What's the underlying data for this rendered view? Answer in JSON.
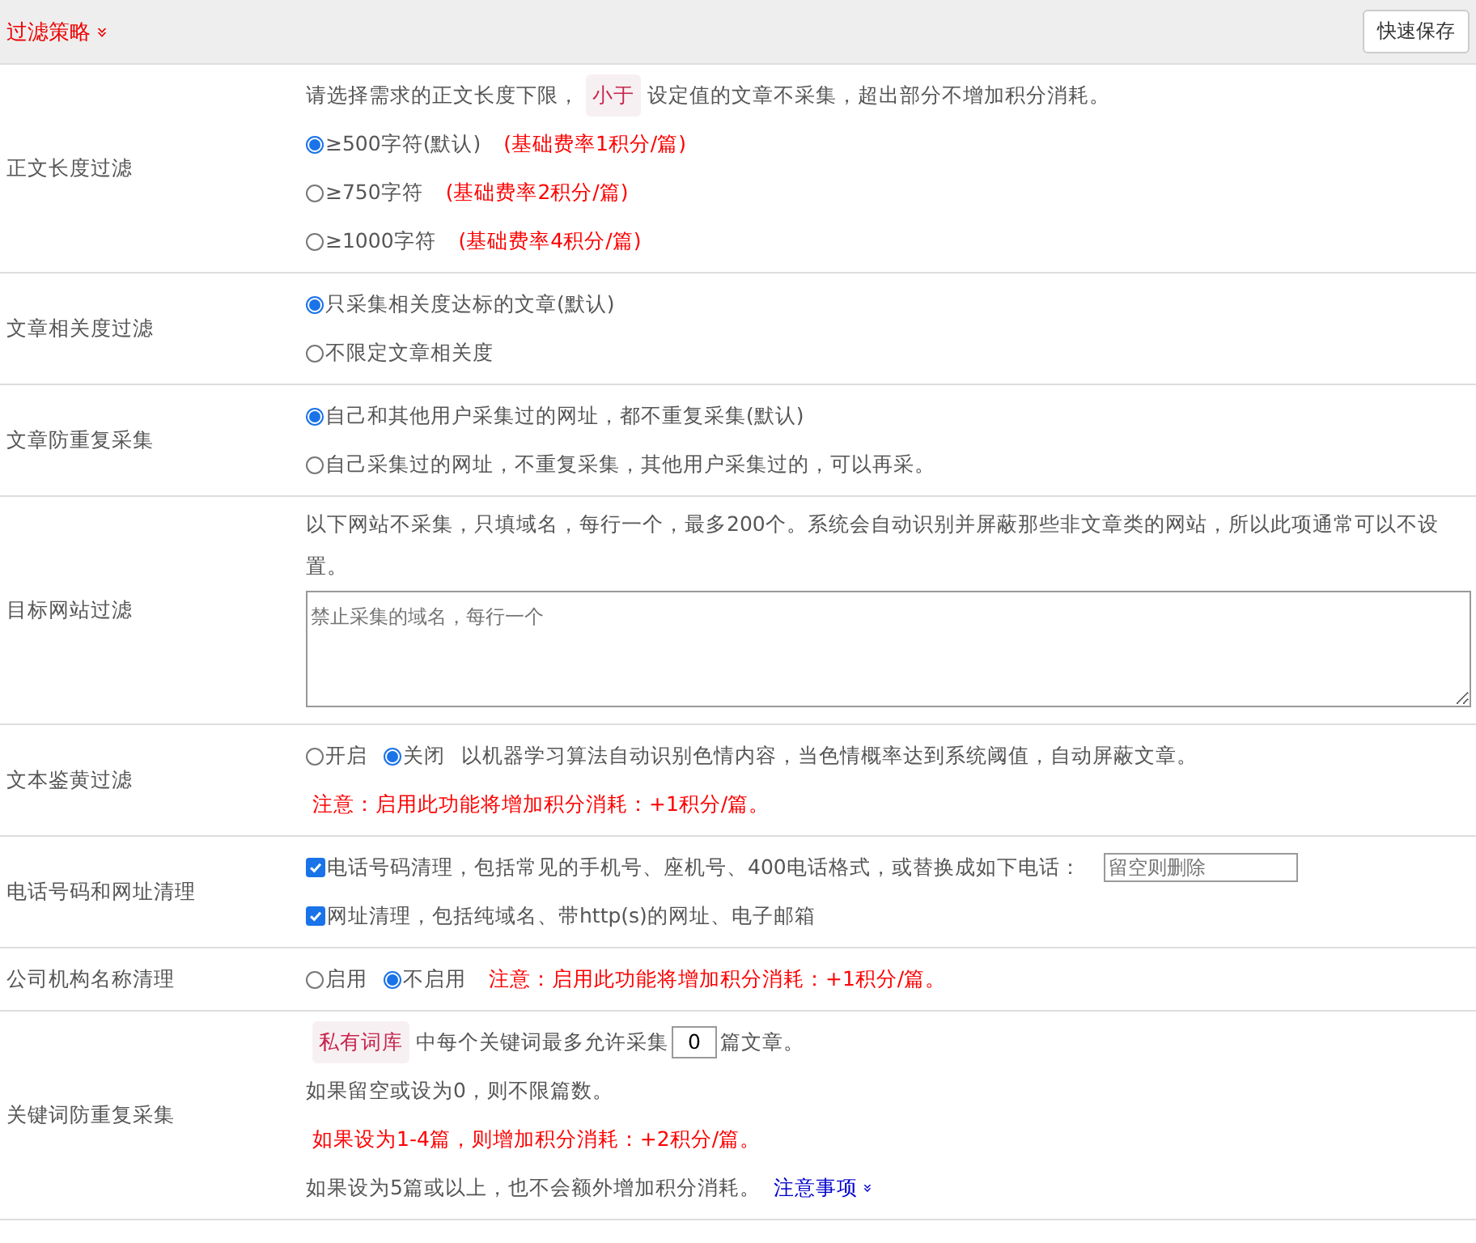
{
  "header": {
    "title": "过滤策略",
    "title_icon": "»",
    "save_button": "快速保存"
  },
  "rows": [
    {
      "label": "正文长度过滤",
      "lines": [
        [
          {
            "kind": "text",
            "text": "请选择需求的正文长度下限，"
          },
          {
            "kind": "tag",
            "text": "小于"
          },
          {
            "kind": "text",
            "text": "设定值的文章不采集，超出部分不增加积分消耗。"
          }
        ],
        [
          {
            "kind": "radio",
            "text": "≥500字符(默认)",
            "selected": true
          },
          {
            "kind": "red",
            "text": "(基础费率1积分/篇)"
          }
        ],
        [
          {
            "kind": "radio",
            "text": "≥750字符",
            "selected": false
          },
          {
            "kind": "red",
            "text": "(基础费率2积分/篇)"
          }
        ],
        [
          {
            "kind": "radio",
            "text": "≥1000字符",
            "selected": false
          },
          {
            "kind": "red",
            "text": "(基础费率4积分/篇)"
          }
        ]
      ]
    },
    {
      "label": "文章相关度过滤",
      "lines": [
        [
          {
            "kind": "radio",
            "text": "只采集相关度达标的文章(默认)",
            "selected": true
          }
        ],
        [
          {
            "kind": "radio",
            "text": "不限定文章相关度",
            "selected": false
          }
        ]
      ]
    },
    {
      "label": "文章防重复采集",
      "lines": [
        [
          {
            "kind": "radio",
            "text": "自己和其他用户采集过的网址，都不重复采集(默认)",
            "selected": true
          }
        ],
        [
          {
            "kind": "radio",
            "text": "自己采集过的网址，不重复采集，其他用户采集过的，可以再采。",
            "selected": false
          }
        ]
      ]
    },
    {
      "label": "目标网站过滤",
      "lines": [
        [
          {
            "kind": "text",
            "text": "以下网站不采集，只填域名，每行一个，最多200个。系统会自动识别并屏蔽那些非文章类的网站，所以此项通常可以不设置。"
          }
        ],
        [
          {
            "kind": "textarea",
            "placeholder": "禁止采集的域名，每行一个"
          }
        ]
      ]
    },
    {
      "label": "文本鉴黄过滤",
      "lines": [
        [
          {
            "kind": "radio",
            "text": "开启",
            "selected": false
          },
          {
            "kind": "radio",
            "text": "关闭",
            "selected": true
          },
          {
            "kind": "text",
            "text": "以机器学习算法自动识别色情内容，当色情概率达到系统阈值，自动屏蔽文章。"
          }
        ],
        [
          {
            "kind": "red",
            "text": "注意：启用此功能将增加积分消耗：+1积分/篇。"
          }
        ]
      ]
    },
    {
      "label": "电话号码和网址清理",
      "lines": [
        [
          {
            "kind": "checkbox",
            "text": "电话号码清理，包括常见的手机号、座机号、400电话格式，或替换成如下电话：",
            "checked": true
          },
          {
            "kind": "input",
            "placeholder": "留空则删除"
          }
        ],
        [
          {
            "kind": "checkbox",
            "text": "网址清理，包括纯域名、带http(s)的网址、电子邮箱",
            "checked": true
          }
        ]
      ]
    },
    {
      "label": "公司机构名称清理",
      "lines": [
        [
          {
            "kind": "radio",
            "text": "启用",
            "selected": false
          },
          {
            "kind": "radio",
            "text": "不启用",
            "selected": true
          },
          {
            "kind": "red",
            "text": "注意：启用此功能将增加积分消耗：+1积分/篇。"
          }
        ]
      ]
    },
    {
      "label": "关键词防重复采集",
      "lines": [
        [
          {
            "kind": "tag",
            "text": "私有词库"
          },
          {
            "kind": "text",
            "text": "中每个关键词最多允许采集"
          },
          {
            "kind": "number",
            "value": "0"
          },
          {
            "kind": "text",
            "text": "篇文章。"
          }
        ],
        [
          {
            "kind": "text",
            "text": "如果留空或设为0，则不限篇数。"
          }
        ],
        [
          {
            "kind": "red",
            "text": "如果设为1-4篇，则增加积分消耗：+2积分/篇。"
          }
        ],
        [
          {
            "kind": "text",
            "text": "如果设为5篇或以上，也不会额外增加积分消耗。"
          },
          {
            "kind": "link",
            "text": "注意事项",
            "icon": "»"
          }
        ]
      ]
    }
  ]
}
